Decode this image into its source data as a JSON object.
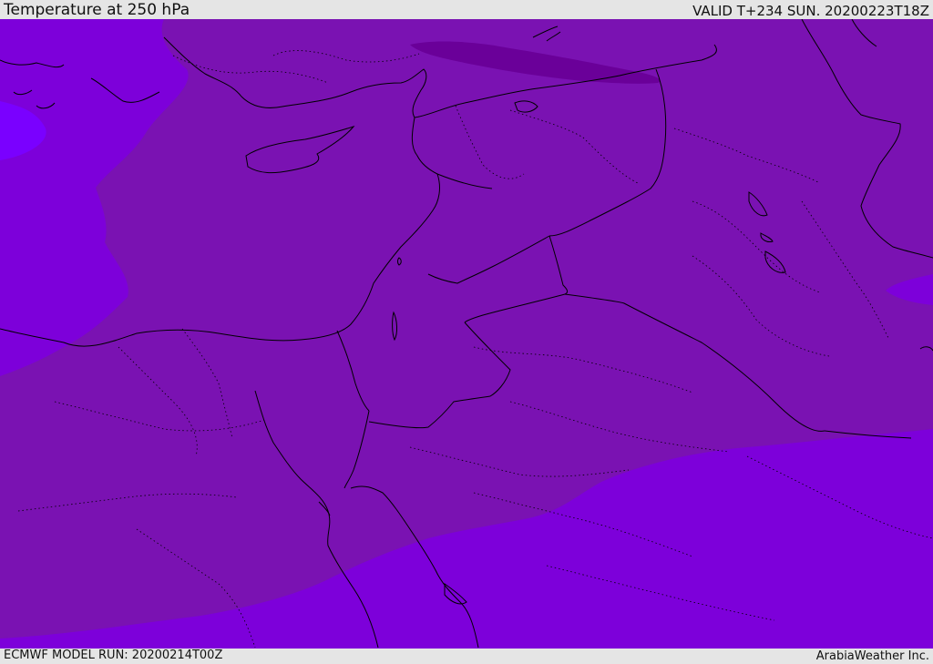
{
  "header": {
    "title": "Temperature at 250 hPa",
    "valid": "VALID T+234 SUN. 20200223T18Z"
  },
  "footer": {
    "model_run": "ECMWF MODEL RUN: 20200214T00Z",
    "credit": "ArabiaWeather Inc."
  },
  "map": {
    "variable": "temperature",
    "level_hpa": 250,
    "colors": {
      "band_main": "#7a12b2",
      "band_warm": "#7d00da",
      "band_warmest": "#7a00ff",
      "band_cold": "#6a0099",
      "coastline": "#000000",
      "border": "#000000"
    }
  }
}
